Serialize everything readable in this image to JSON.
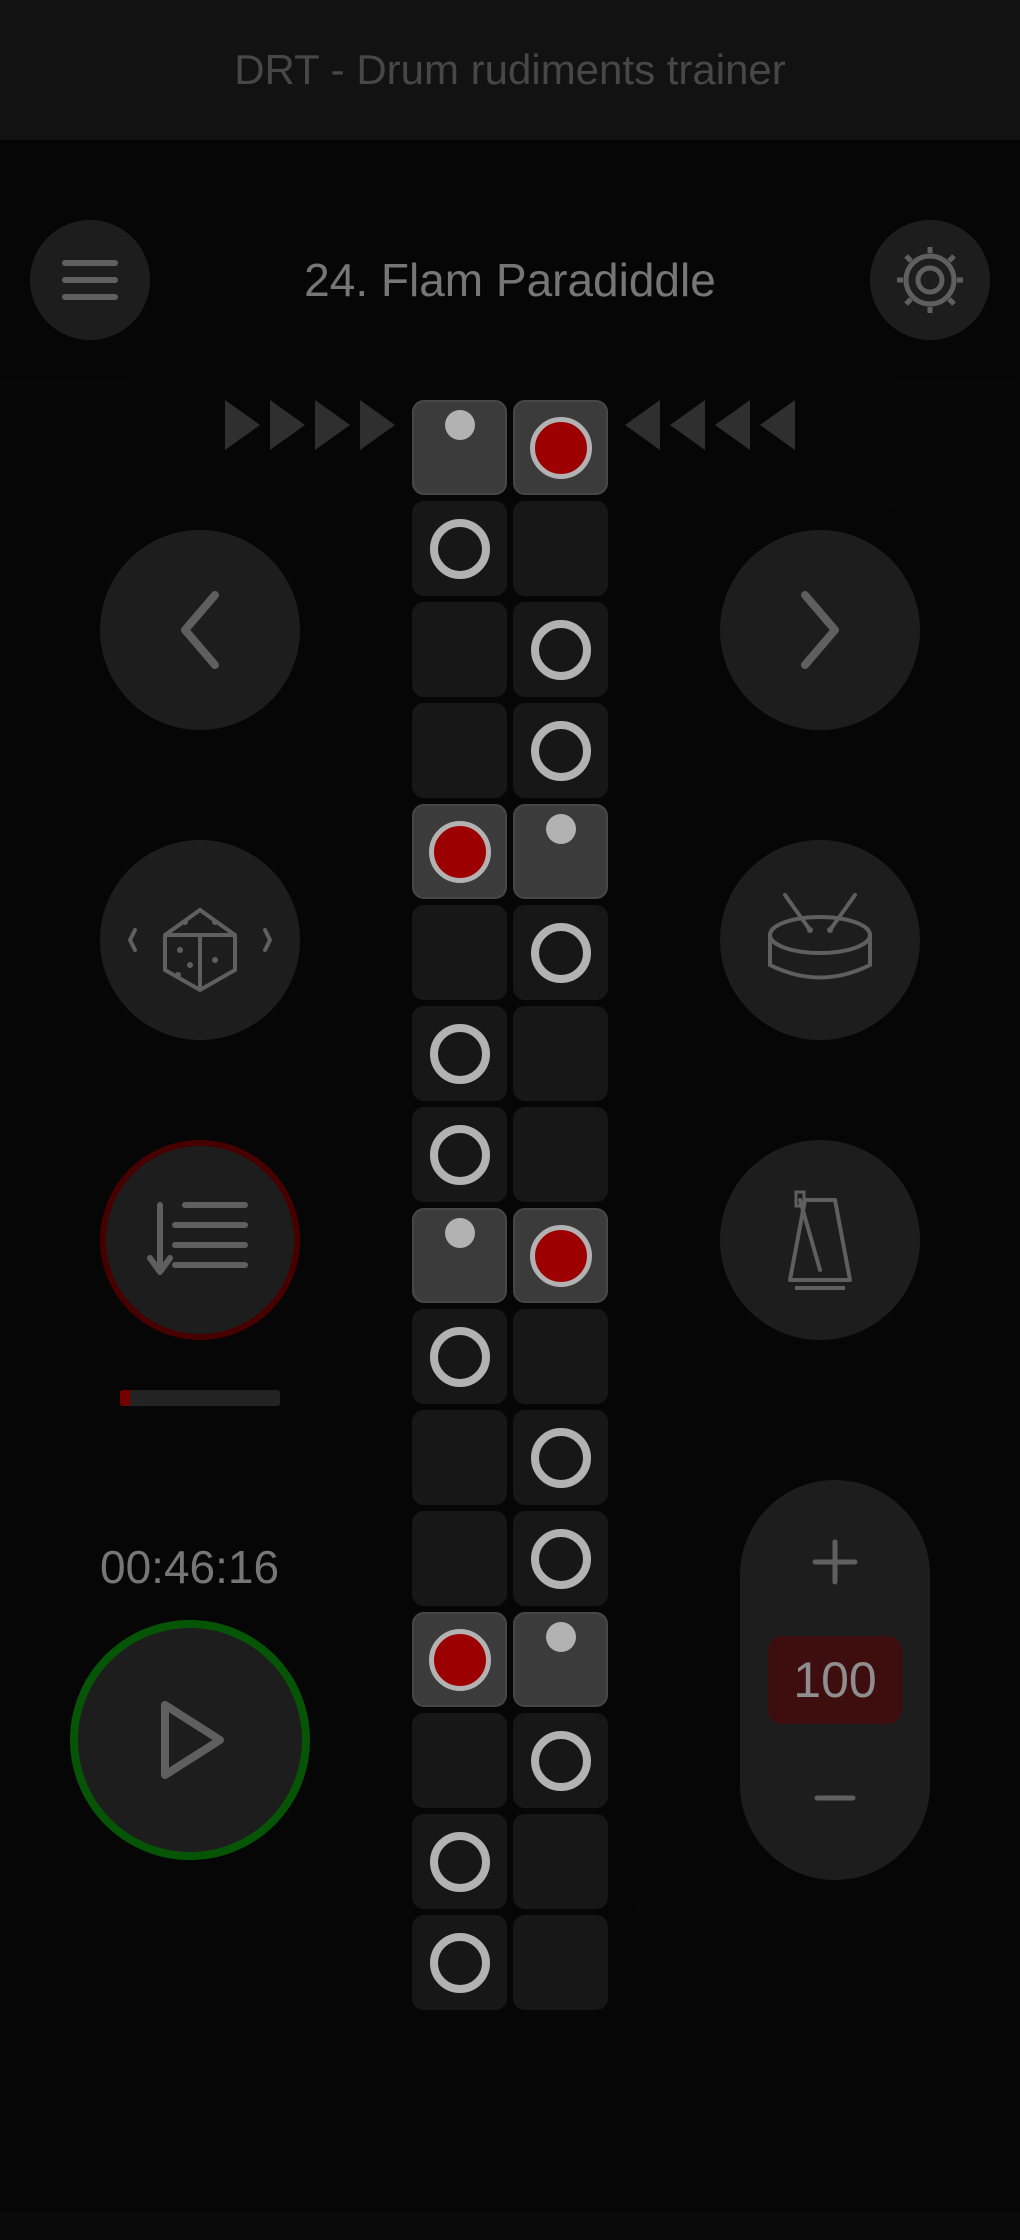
{
  "app_title": "DRT - Drum rudiments trainer",
  "rudiment_title": "24. Flam Paradiddle",
  "timer": "00:46:16",
  "bpm": "100",
  "progress_pct": 6,
  "icons": {
    "menu": "menu-icon",
    "settings": "gear-icon",
    "prev": "chevron-left-icon",
    "next": "chevron-right-icon",
    "dice": "dice-icon",
    "drum": "drum-icon",
    "list": "list-icon",
    "metronome": "metronome-icon",
    "play": "play-icon",
    "plus": "plus-icon",
    "minus": "minus-icon"
  },
  "pattern": {
    "left": [
      "grace",
      "ring",
      "",
      "",
      "accent",
      "",
      "ring",
      "ring",
      "grace",
      "ring",
      "",
      "",
      "accent",
      "",
      "ring",
      "ring"
    ],
    "right": [
      "accent",
      "",
      "ring",
      "ring",
      "grace",
      "ring",
      "",
      "",
      "accent",
      "",
      "ring",
      "ring",
      "grace",
      "ring",
      "",
      ""
    ]
  },
  "colors": {
    "accent_red": "#e00000",
    "ring_white": "#ffffff",
    "play_border": "#0a7a0a",
    "list_border": "#660000"
  }
}
